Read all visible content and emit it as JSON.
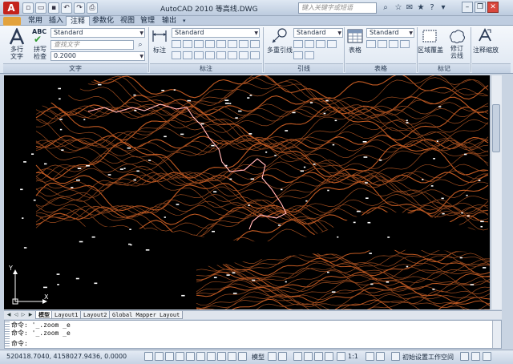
{
  "titlebar": {
    "app_logo": "A",
    "title": "AutoCAD 2010     等高线.DWG",
    "search_placeholder": "键入关键字或短语",
    "quick_access_icons": [
      "new-icon",
      "open-icon",
      "save-icon",
      "undo-icon",
      "redo-icon",
      "print-icon"
    ],
    "window_controls": {
      "minimize": "–",
      "restore": "❐",
      "close": "✕"
    }
  },
  "menu_tabs": [
    "常用",
    "插入",
    "注释",
    "参数化",
    "视图",
    "管理",
    "输出"
  ],
  "active_tab": "注释",
  "ribbon": {
    "text_panel": {
      "multiline_text": "多行\n文字",
      "spellcheck": "拼写\n检查",
      "abc": "ABC",
      "style_combo": "Standard",
      "find_placeholder": "查找文字",
      "height_combo": "0.2000",
      "label": "文字"
    },
    "dim_panel": {
      "dimension": "标注",
      "style_combo": "Standard",
      "label": "标注"
    },
    "leader_panel": {
      "multileader": "多重引线",
      "style_combo": "Standard",
      "label": "引线"
    },
    "table_panel": {
      "table": "表格",
      "style_combo": "Standard",
      "label": "表格"
    },
    "markup_panel": {
      "wipeout": "区域覆盖",
      "revcloud": "修订\n云线",
      "label": "标记"
    },
    "scale_panel": {
      "anno_scale": "注释缩放"
    }
  },
  "layout_tabs": [
    "模型",
    "Layout1",
    "Layout2",
    "Global Mapper Layout"
  ],
  "active_layout": "模型",
  "command_lines": [
    "命令: '_.zoom _e",
    "命令: '_.zoom _e",
    "命令:"
  ],
  "statusbar": {
    "coords": "520418.7040, 4158027.9436, 0.0000",
    "model_label": "模型",
    "anno_scale": "1:1",
    "workspace": "初始设置工作空间"
  },
  "ucs": {
    "x_label": "X",
    "y_label": "Y"
  },
  "colors": {
    "contour": "#9a4a1e",
    "contour_bright": "#c25a22",
    "path_line": "#ff5a5a",
    "canvas_bg": "#000000"
  }
}
